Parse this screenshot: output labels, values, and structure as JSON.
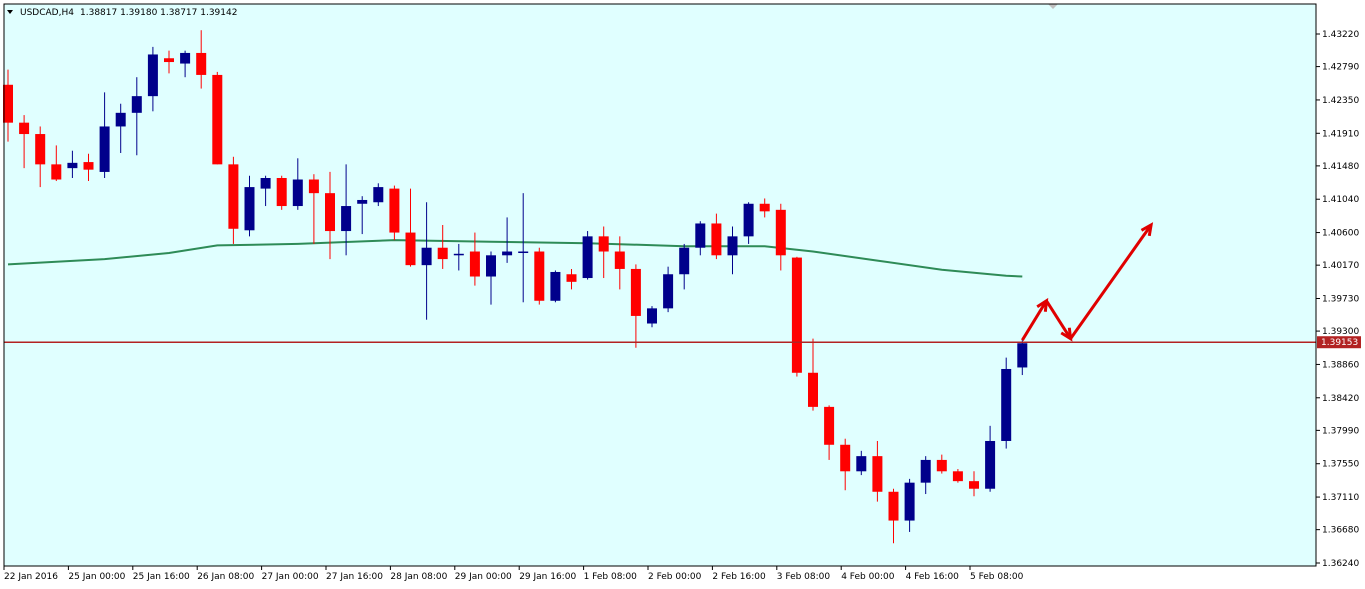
{
  "header": {
    "symbol": "USDCAD,H4",
    "ohlc": "1.38817 1.39180 1.38717 1.39142"
  },
  "colors": {
    "background": "#e0ffff",
    "bull": "#00008b",
    "bear": "#ff0000",
    "ma": "#2e8b57",
    "level": "#b22222",
    "price_tag": "#b22222",
    "arrow": "#e00000"
  },
  "chart_data": {
    "type": "candlestick",
    "symbol": "USDCAD",
    "timeframe": "H4",
    "ylim": [
      1.3624,
      1.434
    ],
    "y_ticks": [
      "1.43220",
      "1.42790",
      "1.42350",
      "1.41910",
      "1.41480",
      "1.41040",
      "1.40600",
      "1.40170",
      "1.39730",
      "1.39300",
      "1.38860",
      "1.38420",
      "1.37990",
      "1.37550",
      "1.37110",
      "1.36680",
      "1.36240"
    ],
    "x_labels": [
      {
        "i": 0,
        "label": "22 Jan 2016"
      },
      {
        "i": 4,
        "label": "25 Jan 00:00"
      },
      {
        "i": 8,
        "label": "25 Jan 16:00"
      },
      {
        "i": 12,
        "label": "26 Jan 08:00"
      },
      {
        "i": 16,
        "label": "27 Jan 00:00"
      },
      {
        "i": 20,
        "label": "27 Jan 16:00"
      },
      {
        "i": 24,
        "label": "28 Jan 08:00"
      },
      {
        "i": 28,
        "label": "29 Jan 00:00"
      },
      {
        "i": 32,
        "label": "29 Jan 16:00"
      },
      {
        "i": 36,
        "label": "1 Feb 08:00"
      },
      {
        "i": 40,
        "label": "2 Feb 00:00"
      },
      {
        "i": 44,
        "label": "2 Feb 16:00"
      },
      {
        "i": 48,
        "label": "3 Feb 08:00"
      },
      {
        "i": 52,
        "label": "4 Feb 00:00"
      },
      {
        "i": 56,
        "label": "4 Feb 16:00"
      },
      {
        "i": 60,
        "label": "5 Feb 08:00"
      }
    ],
    "candles": [
      {
        "o": 1.4255,
        "h": 1.4275,
        "l": 1.418,
        "c": 1.4205
      },
      {
        "o": 1.4205,
        "h": 1.4215,
        "l": 1.4145,
        "c": 1.419
      },
      {
        "o": 1.419,
        "h": 1.42,
        "l": 1.412,
        "c": 1.415
      },
      {
        "o": 1.415,
        "h": 1.4175,
        "l": 1.4128,
        "c": 1.413
      },
      {
        "o": 1.4145,
        "h": 1.4168,
        "l": 1.4132,
        "c": 1.4152
      },
      {
        "o": 1.4153,
        "h": 1.4164,
        "l": 1.4128,
        "c": 1.4143
      },
      {
        "o": 1.414,
        "h": 1.4245,
        "l": 1.4132,
        "c": 1.42
      },
      {
        "o": 1.42,
        "h": 1.423,
        "l": 1.4165,
        "c": 1.4218
      },
      {
        "o": 1.4218,
        "h": 1.4265,
        "l": 1.4162,
        "c": 1.424
      },
      {
        "o": 1.424,
        "h": 1.4305,
        "l": 1.422,
        "c": 1.4295
      },
      {
        "o": 1.429,
        "h": 1.43,
        "l": 1.427,
        "c": 1.4285
      },
      {
        "o": 1.4283,
        "h": 1.43,
        "l": 1.4265,
        "c": 1.4297
      },
      {
        "o": 1.4297,
        "h": 1.4327,
        "l": 1.425,
        "c": 1.4268
      },
      {
        "o": 1.4268,
        "h": 1.4272,
        "l": 1.415,
        "c": 1.415
      },
      {
        "o": 1.415,
        "h": 1.416,
        "l": 1.4045,
        "c": 1.4065
      },
      {
        "o": 1.4063,
        "h": 1.4135,
        "l": 1.4055,
        "c": 1.412
      },
      {
        "o": 1.4118,
        "h": 1.4135,
        "l": 1.4095,
        "c": 1.4132
      },
      {
        "o": 1.4132,
        "h": 1.4135,
        "l": 1.409,
        "c": 1.4095
      },
      {
        "o": 1.4095,
        "h": 1.4158,
        "l": 1.409,
        "c": 1.413
      },
      {
        "o": 1.413,
        "h": 1.4137,
        "l": 1.4045,
        "c": 1.4112
      },
      {
        "o": 1.4112,
        "h": 1.414,
        "l": 1.4025,
        "c": 1.4062
      },
      {
        "o": 1.4062,
        "h": 1.415,
        "l": 1.403,
        "c": 1.4095
      },
      {
        "o": 1.4098,
        "h": 1.4108,
        "l": 1.4058,
        "c": 1.4103
      },
      {
        "o": 1.41,
        "h": 1.4125,
        "l": 1.4095,
        "c": 1.412
      },
      {
        "o": 1.4118,
        "h": 1.4122,
        "l": 1.405,
        "c": 1.406
      },
      {
        "o": 1.406,
        "h": 1.4118,
        "l": 1.4015,
        "c": 1.4017
      },
      {
        "o": 1.4017,
        "h": 1.41,
        "l": 1.3945,
        "c": 1.404
      },
      {
        "o": 1.404,
        "h": 1.407,
        "l": 1.4012,
        "c": 1.4025
      },
      {
        "o": 1.403,
        "h": 1.4045,
        "l": 1.401,
        "c": 1.4032
      },
      {
        "o": 1.4035,
        "h": 1.406,
        "l": 1.399,
        "c": 1.4002
      },
      {
        "o": 1.4002,
        "h": 1.4035,
        "l": 1.3965,
        "c": 1.403
      },
      {
        "o": 1.403,
        "h": 1.408,
        "l": 1.402,
        "c": 1.4035
      },
      {
        "o": 1.4035,
        "h": 1.4112,
        "l": 1.3968,
        "c": 1.4035
      },
      {
        "o": 1.4035,
        "h": 1.404,
        "l": 1.3965,
        "c": 1.397
      },
      {
        "o": 1.397,
        "h": 1.401,
        "l": 1.3968,
        "c": 1.4008
      },
      {
        "o": 1.4005,
        "h": 1.4012,
        "l": 1.3985,
        "c": 1.3995
      },
      {
        "o": 1.4,
        "h": 1.4062,
        "l": 1.3998,
        "c": 1.4055
      },
      {
        "o": 1.4055,
        "h": 1.4068,
        "l": 1.4,
        "c": 1.4035
      },
      {
        "o": 1.4035,
        "h": 1.4055,
        "l": 1.3985,
        "c": 1.4012
      },
      {
        "o": 1.4012,
        "h": 1.4018,
        "l": 1.3908,
        "c": 1.395
      },
      {
        "o": 1.394,
        "h": 1.3963,
        "l": 1.3935,
        "c": 1.396
      },
      {
        "o": 1.396,
        "h": 1.4015,
        "l": 1.3955,
        "c": 1.4005
      },
      {
        "o": 1.4005,
        "h": 1.4045,
        "l": 1.3985,
        "c": 1.404
      },
      {
        "o": 1.404,
        "h": 1.4075,
        "l": 1.403,
        "c": 1.4072
      },
      {
        "o": 1.4072,
        "h": 1.4085,
        "l": 1.4025,
        "c": 1.403
      },
      {
        "o": 1.403,
        "h": 1.4068,
        "l": 1.4005,
        "c": 1.4055
      },
      {
        "o": 1.4055,
        "h": 1.41,
        "l": 1.4045,
        "c": 1.4098
      },
      {
        "o": 1.4098,
        "h": 1.4105,
        "l": 1.408,
        "c": 1.4088
      },
      {
        "o": 1.409,
        "h": 1.4098,
        "l": 1.401,
        "c": 1.403
      },
      {
        "o": 1.4027,
        "h": 1.4028,
        "l": 1.387,
        "c": 1.3875
      },
      {
        "o": 1.3875,
        "h": 1.392,
        "l": 1.3825,
        "c": 1.383
      },
      {
        "o": 1.383,
        "h": 1.3832,
        "l": 1.376,
        "c": 1.378
      },
      {
        "o": 1.378,
        "h": 1.3788,
        "l": 1.372,
        "c": 1.3745
      },
      {
        "o": 1.3745,
        "h": 1.3772,
        "l": 1.374,
        "c": 1.3765
      },
      {
        "o": 1.3765,
        "h": 1.3785,
        "l": 1.3705,
        "c": 1.3718
      },
      {
        "o": 1.3718,
        "h": 1.3722,
        "l": 1.365,
        "c": 1.368
      },
      {
        "o": 1.368,
        "h": 1.3735,
        "l": 1.3665,
        "c": 1.373
      },
      {
        "o": 1.373,
        "h": 1.3765,
        "l": 1.3715,
        "c": 1.376
      },
      {
        "o": 1.376,
        "h": 1.3767,
        "l": 1.3742,
        "c": 1.3745
      },
      {
        "o": 1.3745,
        "h": 1.3748,
        "l": 1.373,
        "c": 1.3732
      },
      {
        "o": 1.3732,
        "h": 1.3745,
        "l": 1.3712,
        "c": 1.3722
      },
      {
        "o": 1.3722,
        "h": 1.3805,
        "l": 1.3718,
        "c": 1.3785
      },
      {
        "o": 1.3785,
        "h": 1.3895,
        "l": 1.3775,
        "c": 1.388
      },
      {
        "o": 1.3882,
        "h": 1.3918,
        "l": 1.3872,
        "c": 1.3914
      }
    ],
    "ma": [
      {
        "i": 0,
        "v": 1.4018
      },
      {
        "i": 6,
        "v": 1.4025
      },
      {
        "i": 10,
        "v": 1.4033
      },
      {
        "i": 13,
        "v": 1.4043
      },
      {
        "i": 18,
        "v": 1.4045
      },
      {
        "i": 24,
        "v": 1.405
      },
      {
        "i": 30,
        "v": 1.4048
      },
      {
        "i": 36,
        "v": 1.4046
      },
      {
        "i": 42,
        "v": 1.4042
      },
      {
        "i": 47,
        "v": 1.4042
      },
      {
        "i": 50,
        "v": 1.4035
      },
      {
        "i": 54,
        "v": 1.4023
      },
      {
        "i": 58,
        "v": 1.4011
      },
      {
        "i": 62,
        "v": 1.4003
      },
      {
        "i": 63,
        "v": 1.4002
      }
    ],
    "level": {
      "value": 1.39153,
      "label": "1.39153"
    },
    "forecast": [
      {
        "i": 63,
        "v": 1.3918
      },
      {
        "i": 64.5,
        "v": 1.397
      },
      {
        "i": 66,
        "v": 1.392
      },
      {
        "i": 71,
        "v": 1.407
      }
    ]
  }
}
